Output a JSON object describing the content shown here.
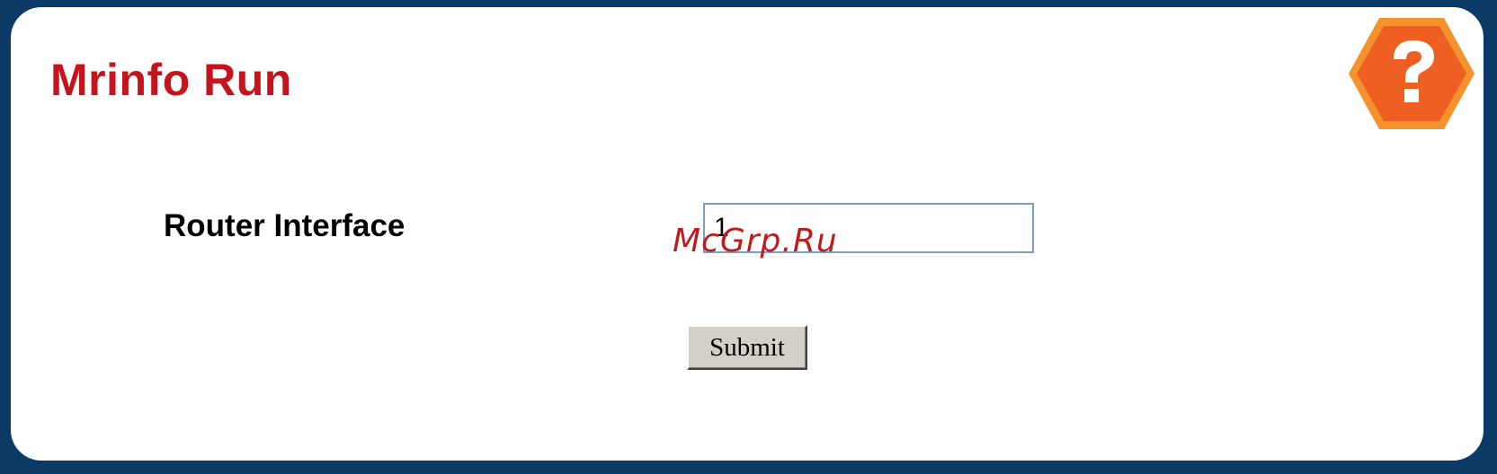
{
  "page": {
    "title": "Mrinfo Run",
    "help_icon": "help-question-icon"
  },
  "form": {
    "router_interface": {
      "label": "Router Interface",
      "value": "1"
    },
    "submit_label": "Submit"
  },
  "watermark": {
    "text": "McGrp.Ru"
  },
  "colors": {
    "background": "#0b3a66",
    "title": "#c4151c",
    "help_icon_outer": "#f4932d",
    "help_icon_inner": "#ef5f22",
    "button_face": "#d4d0c8"
  }
}
